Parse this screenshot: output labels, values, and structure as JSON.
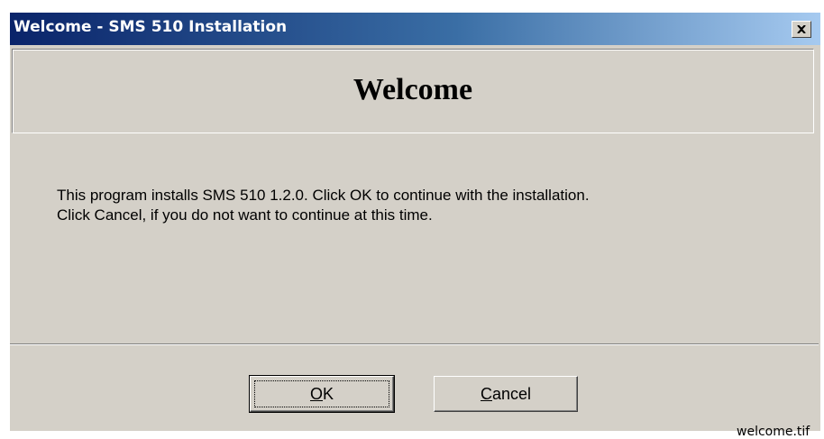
{
  "window": {
    "title": "Welcome - SMS 510 Installation",
    "close_icon": "close-icon"
  },
  "header": {
    "title": "Welcome"
  },
  "message": {
    "line1": "This program installs SMS 510 1.2.0. Click OK to continue with the installation.",
    "line2": "Click Cancel, if you do not want to continue at this time."
  },
  "buttons": {
    "ok": {
      "mnemonic": "O",
      "rest": "K"
    },
    "cancel": {
      "mnemonic": "C",
      "rest": "ancel"
    }
  },
  "file_tag": "welcome.tif",
  "colors": {
    "face": "#d4d0c8",
    "title_start": "#0a246a",
    "title_end": "#a6caf0"
  }
}
